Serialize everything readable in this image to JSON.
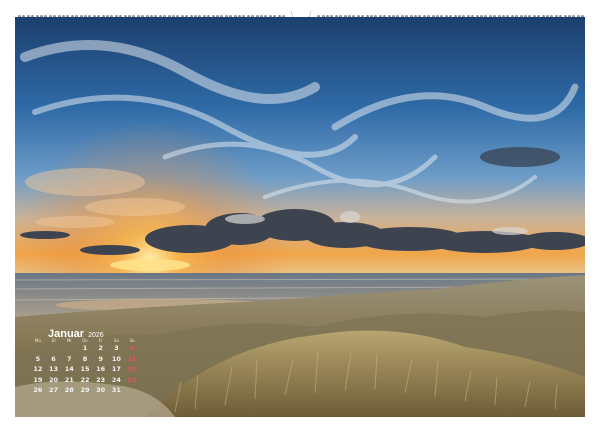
{
  "calendar": {
    "month": "Januar",
    "year": "2026",
    "weekdays": [
      "Mo",
      "Di",
      "Mi",
      "Do",
      "Fr",
      "Sa",
      "So"
    ],
    "weeks": [
      [
        "",
        "",
        "",
        "1",
        "2",
        "3",
        "4"
      ],
      [
        "5",
        "6",
        "7",
        "8",
        "9",
        "10",
        "11"
      ],
      [
        "12",
        "13",
        "14",
        "15",
        "16",
        "17",
        "18"
      ],
      [
        "19",
        "20",
        "21",
        "22",
        "23",
        "24",
        "25"
      ],
      [
        "26",
        "27",
        "28",
        "29",
        "30",
        "31",
        ""
      ]
    ],
    "sunday_color": "#e25555"
  },
  "photo": {
    "sky_top_color": "#1f4f86",
    "horizon_glow_color": "#f4a03a",
    "dune_color": "#8a7a58"
  },
  "binding": {
    "hanger_icon": "hanger-notch-icon"
  }
}
